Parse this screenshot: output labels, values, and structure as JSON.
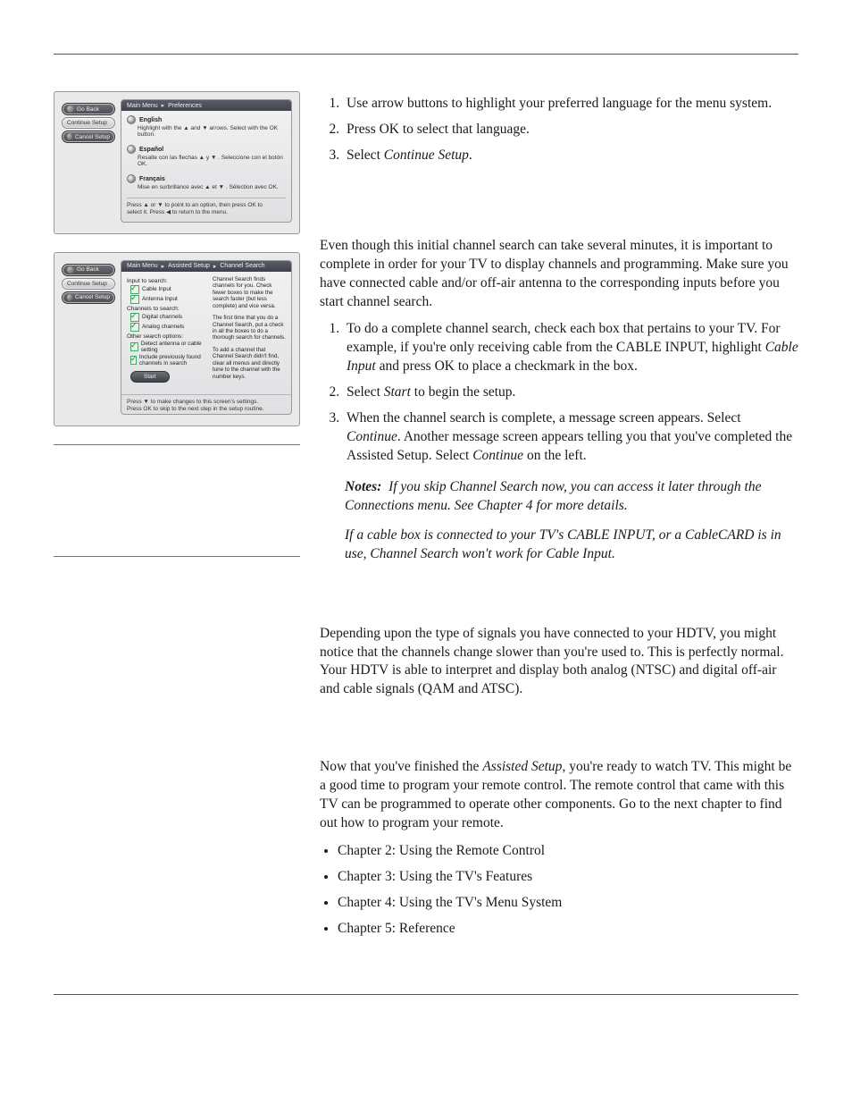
{
  "window1": {
    "side": {
      "go_back": "Go Back",
      "continue": "Continue Setup",
      "cancel": "Cancel Setup"
    },
    "breadcrumb": [
      "Main Menu",
      "Preferences"
    ],
    "langs": [
      {
        "name": "English",
        "hint": "Highlight with the ▲ and ▼ arrows. Select with the OK button."
      },
      {
        "name": "Español",
        "hint": "Resalte con las flechas ▲ y ▼ . Seleccione con el botón OK."
      },
      {
        "name": "Français",
        "hint": "Mise en surbrillance avec ▲ et ▼ . Sélection avec OK."
      }
    ],
    "footer1": "Press ▲ or ▼ to point to an option, then press OK to",
    "footer2": "select it. Press ◀ to return to the menu."
  },
  "window2": {
    "side": {
      "go_back": "Go Back",
      "continue": "Continue Setup",
      "cancel": "Cancel Setup"
    },
    "breadcrumb": [
      "Main Menu",
      "Assisted Setup",
      "Channel Search"
    ],
    "left": {
      "input_label": "Input to search:",
      "inputs": [
        "Cable Input",
        "Antenna Input"
      ],
      "channels_label": "Channels to search:",
      "types": [
        "Digital channels",
        "Analog channels"
      ],
      "other_label": "Other search options:",
      "others": [
        "Detect antenna or cable setting",
        "Include previously found channels in search"
      ],
      "start": "Start"
    },
    "right": {
      "p1": "Channel Search finds channels for you. Check fewer boxes to make the search faster (but less complete) and vice versa.",
      "p2": "The first time that you do a Channel Search, put a check in all the boxes to do a thorough search for channels.",
      "p3": "To add a channel that Channel Search didn't find, clear all menus and directly tune to the channel with the number keys."
    },
    "footer1": "Press ▼ to make changes to this screen's settings.",
    "footer2": "Press OK to skip to the next step in the setup routine."
  },
  "right": {
    "s1": {
      "i1": "Use arrow buttons to highlight your preferred language for the menu system.",
      "i2": "Press OK to select that language.",
      "i3_a": "Select ",
      "i3_b": "Continue Setup",
      "i3_c": "."
    },
    "s2": {
      "intro": "Even though this initial channel search can take several minutes, it is important to complete in order for your TV to display channels and programming. Make sure you have connected cable and/or off-air antenna to the corresponding inputs before you start channel search.",
      "i1_a": "To do a complete channel search, check each box that pertains to your TV. For example, if you're only receiving cable from the CABLE INPUT, highlight ",
      "i1_b": "Cable Input",
      "i1_c": " and press OK to place a checkmark in the box.",
      "i2_a": "Select ",
      "i2_b": "Start",
      "i2_c": " to begin the setup.",
      "i3_a": "When the channel search is complete, a message screen appears. Select ",
      "i3_b": "Continue",
      "i3_c": ". Another message screen appears telling you that you've completed the Assisted Setup. Select ",
      "i3_d": "Continue",
      "i3_e": " on the left.",
      "notes_label": "Notes:",
      "note1": "If you skip Channel Search now, you can access it later through the Connections menu. See Chapter 4 for more details.",
      "note2": "If a cable box is connected to your TV's CABLE INPUT, or a CableCARD is in use, Channel Search won't work for Cable Input."
    },
    "s3": {
      "p": "Depending upon the type of signals you have connected to your HDTV, you might notice that the channels change slower than you're used to. This is perfectly normal. Your HDTV is able to interpret and display both analog (NTSC) and digital off-air and cable signals (QAM and ATSC)."
    },
    "s4": {
      "p_a": "Now that you've finished the ",
      "p_b": "Assisted Setup",
      "p_c": ", you're ready to watch TV. This might be a good time to program your remote control. The remote control that came with this TV can be programmed to operate other components. Go to the next chapter to find out how to program your remote.",
      "bullets": [
        "Chapter 2: Using the Remote Control",
        "Chapter 3: Using the TV's Features",
        "Chapter 4: Using the TV's Menu System",
        "Chapter 5: Reference"
      ]
    }
  }
}
